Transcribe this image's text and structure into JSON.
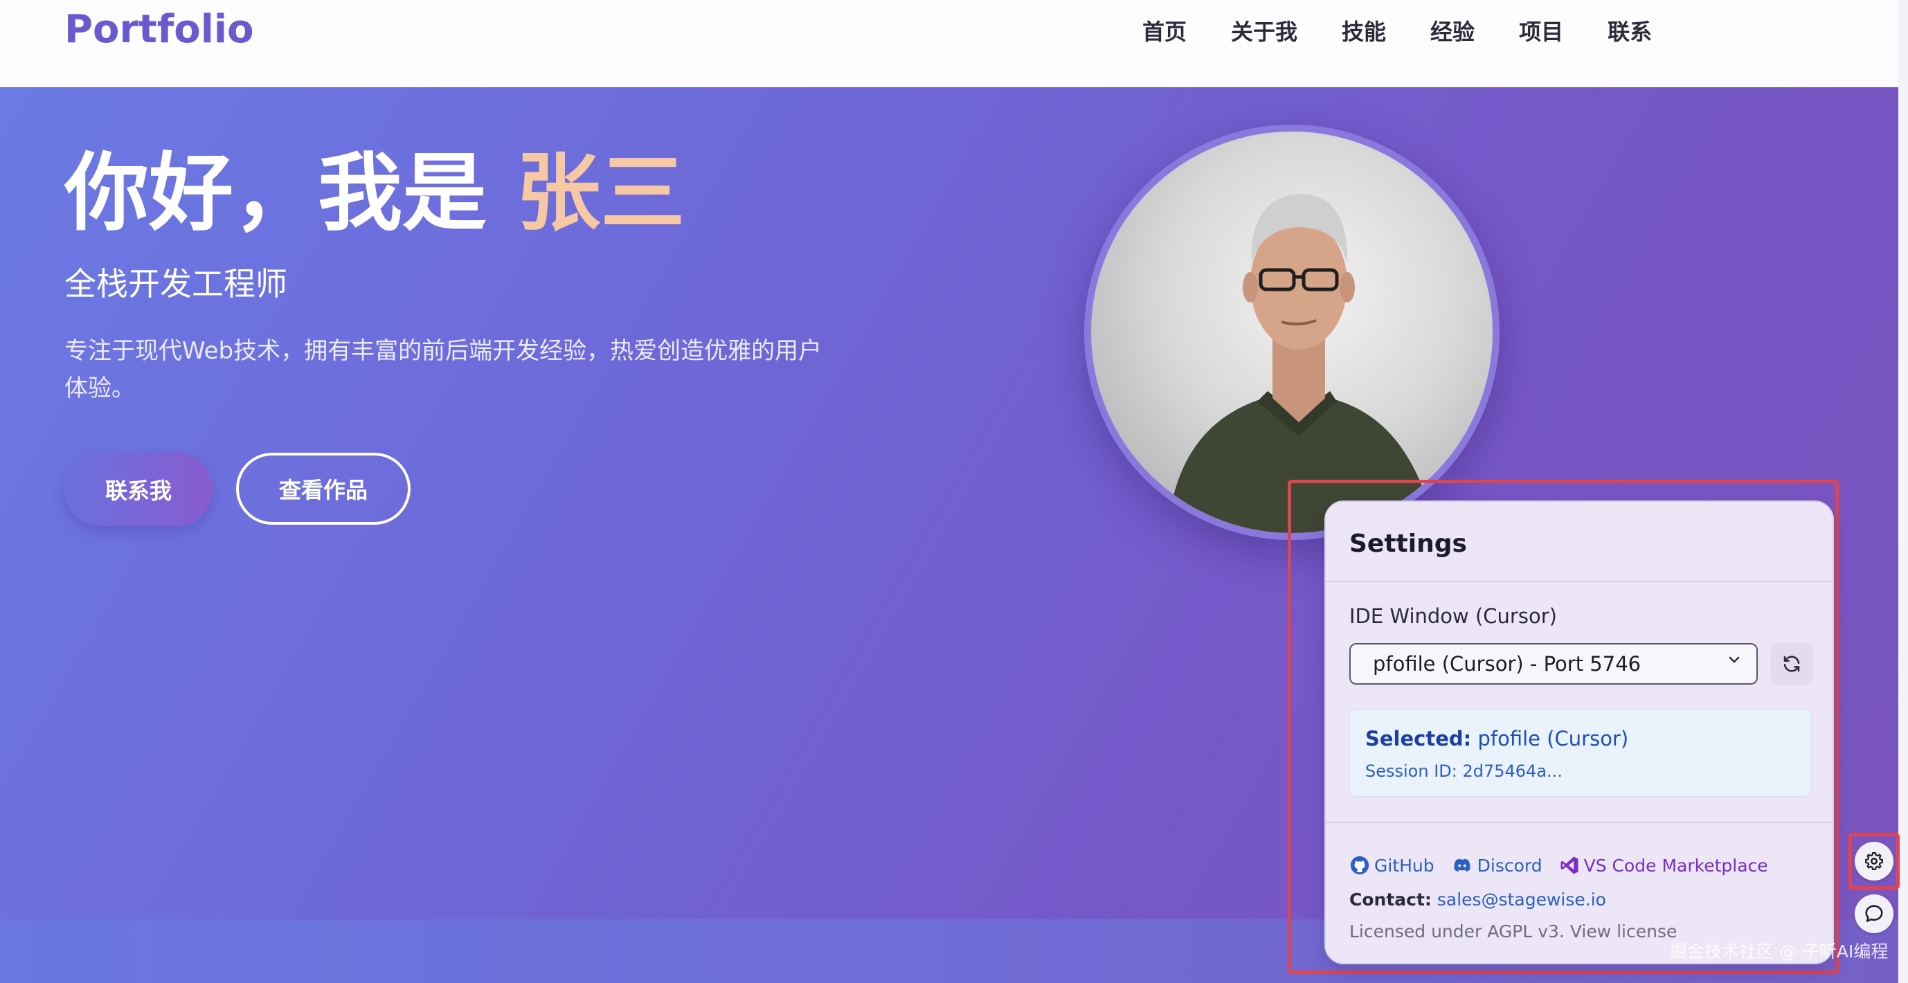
{
  "header": {
    "logo": "Portfolio",
    "nav": [
      "首页",
      "关于我",
      "技能",
      "经验",
      "项目",
      "联系"
    ]
  },
  "hero": {
    "greeting": "你好，我是 ",
    "name": "张三",
    "subtitle": "全栈开发工程师",
    "description": "专注于现代Web技术，拥有丰富的前后端开发经验，热爱创造优雅的用户体验。",
    "btn_contact": "联系我",
    "btn_works": "查看作品"
  },
  "settings": {
    "title": "Settings",
    "ide_label": "IDE Window (Cursor)",
    "ide_selected": "pfofile (Cursor) - Port 5746",
    "selected_label": "Selected:",
    "selected_value": "pfofile (Cursor)",
    "session": "Session ID: 2d75464a...",
    "links": {
      "github": "GitHub",
      "discord": "Discord",
      "vscode": "VS Code Marketplace"
    },
    "contact_label": "Contact:",
    "contact_email": "sales@stagewise.io",
    "license_text": "Licensed under AGPL v3.",
    "license_link": "View license"
  },
  "watermark": "掘金技术社区 @ 子昕AI编程",
  "colors": {
    "accent": "#6a5ad0",
    "name_highlight": "#f6c8a3",
    "highlight_border": "#e0454f"
  },
  "icons": [
    "refresh-icon",
    "github-icon",
    "discord-icon",
    "vscode-icon",
    "gear-icon",
    "chat-icon",
    "chevron-down-icon"
  ]
}
